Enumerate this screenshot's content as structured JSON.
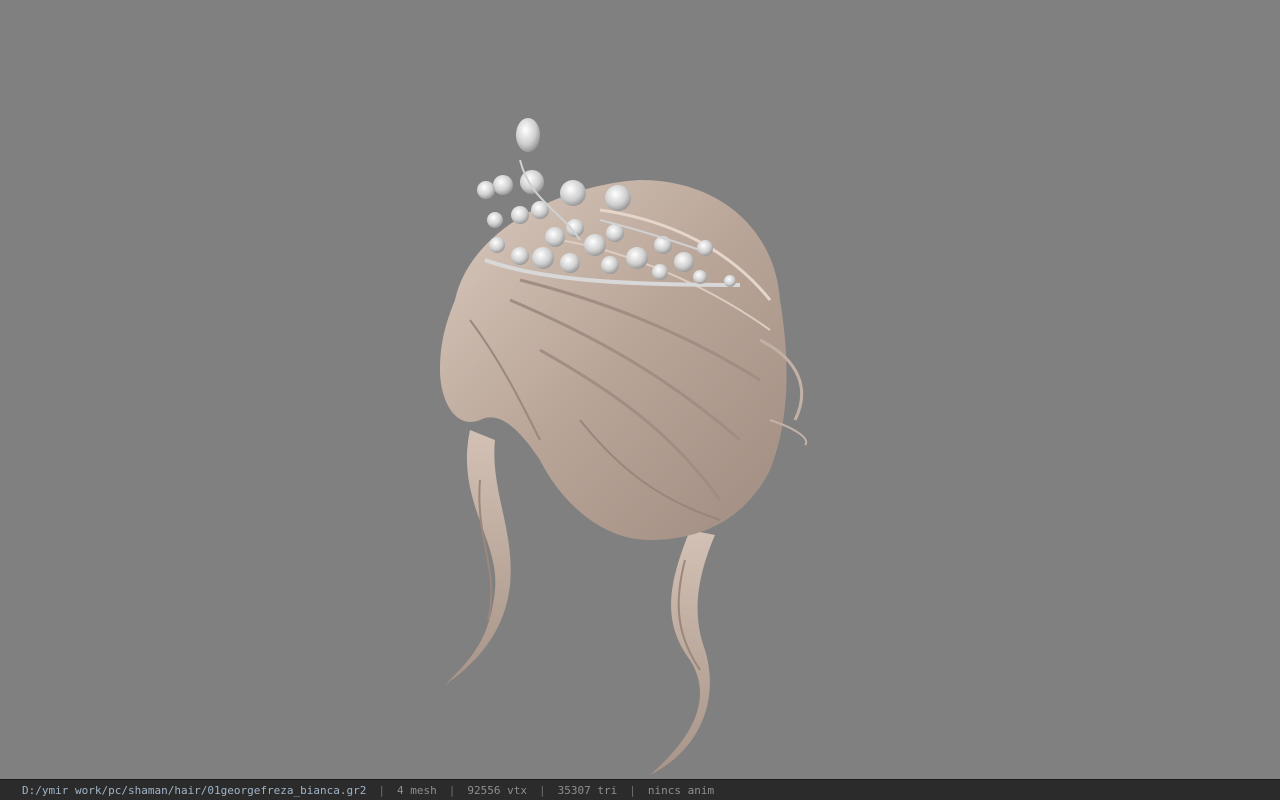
{
  "viewport": {
    "background": "#808080",
    "model": "hair-with-tiara",
    "hair_color": "#c9b7aa",
    "tiara_color": "#e8e8e8"
  },
  "statusbar": {
    "file_path": "D:/ymir work/pc/shaman/hair/01georgefreza_bianca.gr2",
    "separator": "|",
    "mesh_count": "4 mesh",
    "vertex_count": "92556 vtx",
    "triangle_count": "35307 tri",
    "anim": "nincs anim"
  }
}
